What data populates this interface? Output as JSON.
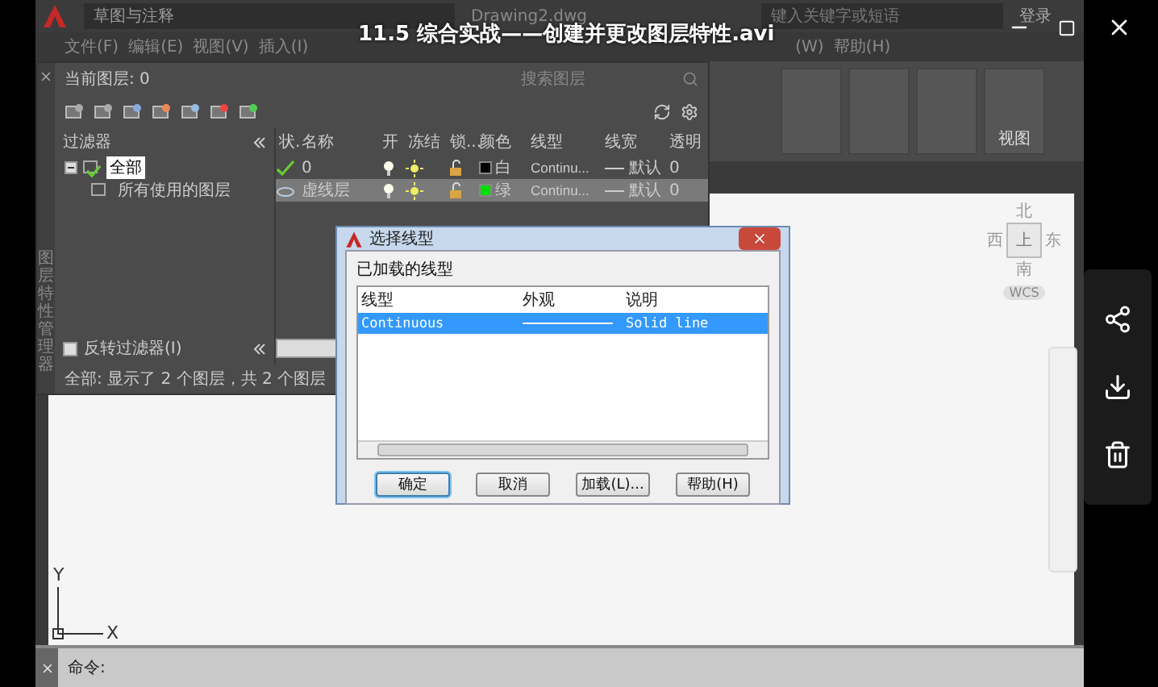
{
  "player": {
    "title": "11.5 综合实战——创建并更改图层特性.avi"
  },
  "app": {
    "workspace": "草图与注释",
    "document": "Drawing2.dwg",
    "search_placeholder": "键入关键字或短语",
    "sign_in": "登录"
  },
  "menu": [
    "文件(F)",
    "编辑(E)",
    "视图(V)",
    "插入(I)",
    "(W)",
    "帮助(H)"
  ],
  "ribbon": {
    "panel_label": "视图"
  },
  "layer_manager": {
    "side_title": "图层特性管理器",
    "current_layer": "当前图层: 0",
    "search_placeholder": "搜索图层",
    "filters_header": "过滤器",
    "filter_tree": [
      {
        "label": "全部",
        "selected": true,
        "children": [
          {
            "label": "所有使用的图层",
            "selected": false
          }
        ]
      }
    ],
    "invert_filter": {
      "label": "反转过滤器(I)",
      "checked": false
    },
    "columns": [
      "状.",
      "名称",
      "开",
      "冻结",
      "锁...",
      "颜色",
      "线型",
      "线宽",
      "透明"
    ],
    "layers": [
      {
        "current": true,
        "name": "0",
        "color": "#000000",
        "color_name": "白",
        "linetype": "Continu...",
        "lineweight": "默认",
        "transparency": "0",
        "selected": false
      },
      {
        "current": false,
        "name": "虚线层",
        "color": "#00dd00",
        "color_name": "绿",
        "linetype": "Continu...",
        "lineweight": "默认",
        "transparency": "0",
        "selected": true
      }
    ],
    "status": "全部: 显示了 2 个图层，共 2 个图层"
  },
  "dialog": {
    "title": "选择线型",
    "group_label": "已加载的线型",
    "columns": [
      "线型",
      "外观",
      "说明"
    ],
    "linetypes": [
      {
        "name": "Continuous",
        "description": "Solid line",
        "selected": true
      }
    ],
    "buttons": [
      {
        "label": "确定",
        "default": true
      },
      {
        "label": "取消",
        "default": false
      },
      {
        "label": "加载(L)...",
        "default": false
      },
      {
        "label": "帮助(H)",
        "default": false
      }
    ]
  },
  "viewcube": {
    "north": "北",
    "west": "西",
    "east": "东",
    "south": "南",
    "face": "上",
    "ucs": "WCS"
  },
  "ucs": {
    "y": "Y",
    "x": "X"
  },
  "command_line": {
    "prompt": "命令:"
  }
}
